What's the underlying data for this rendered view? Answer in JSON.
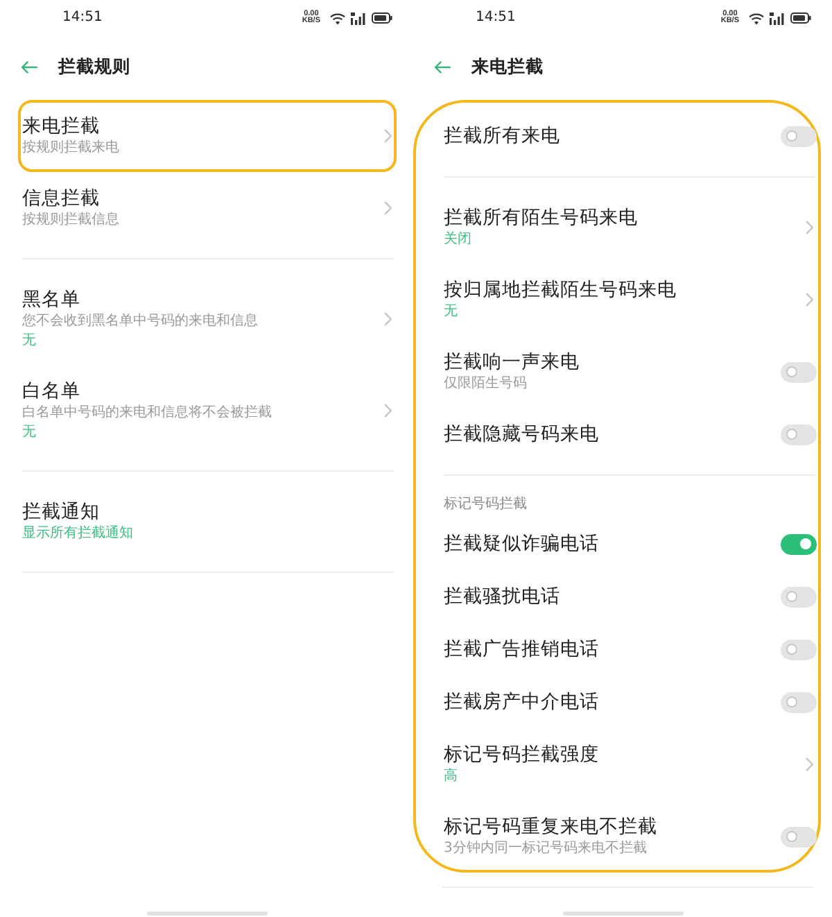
{
  "screens": [
    {
      "status_bar": {
        "time": "14:51",
        "net_speed": "0.00",
        "net_unit": "KB/S"
      },
      "header": {
        "title": "拦截规则"
      },
      "framed": false,
      "groups": [
        {
          "items": [
            {
              "kind": "link",
              "title": "来电拦截",
              "subtitle": "按规则拦截来电",
              "highlighted": true
            },
            {
              "kind": "link",
              "title": "信息拦截",
              "subtitle": "按规则拦截信息",
              "highlighted": false
            }
          ]
        },
        {
          "items": [
            {
              "kind": "link",
              "title": "黑名单",
              "subtitle": "您不会收到黑名单中号码的来电和信息",
              "value": "无",
              "highlighted": false
            },
            {
              "kind": "link",
              "title": "白名单",
              "subtitle": "白名单中号码的来电和信息将不会被拦截",
              "value": "无",
              "highlighted": false
            }
          ]
        },
        {
          "items": [
            {
              "kind": "plain",
              "title": "拦截通知",
              "value": "显示所有拦截通知",
              "highlighted": false
            }
          ]
        }
      ]
    },
    {
      "status_bar": {
        "time": "14:51",
        "net_speed": "0.00",
        "net_unit": "KB/S"
      },
      "header": {
        "title": "来电拦截"
      },
      "framed": true,
      "groups": [
        {
          "items": [
            {
              "kind": "toggle",
              "title": "拦截所有来电",
              "on": false
            }
          ]
        },
        {
          "items": [
            {
              "kind": "link",
              "title": "拦截所有陌生号码来电",
              "value": "关闭"
            },
            {
              "kind": "link",
              "title": "按归属地拦截陌生号码来电",
              "value": "无"
            },
            {
              "kind": "toggle",
              "title": "拦截响一声来电",
              "subtitle": "仅限陌生号码",
              "on": false
            },
            {
              "kind": "toggle",
              "title": "拦截隐藏号码来电",
              "on": false
            }
          ]
        },
        {
          "heading": "标记号码拦截",
          "items": [
            {
              "kind": "toggle",
              "title": "拦截疑似诈骗电话",
              "on": true
            },
            {
              "kind": "toggle",
              "title": "拦截骚扰电话",
              "on": false
            },
            {
              "kind": "toggle",
              "title": "拦截广告推销电话",
              "on": false
            },
            {
              "kind": "toggle",
              "title": "拦截房产中介电话",
              "on": false
            },
            {
              "kind": "link",
              "title": "标记号码拦截强度",
              "value": "高"
            },
            {
              "kind": "toggle",
              "title": "标记号码重复来电不拦截",
              "subtitle": "3分钟内同一标记号码来电不拦截",
              "on": false
            }
          ]
        }
      ]
    }
  ]
}
